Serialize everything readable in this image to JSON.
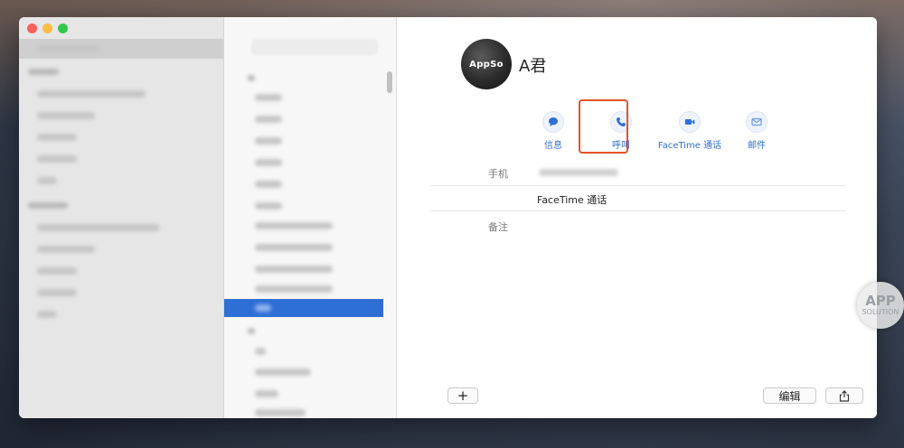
{
  "contact": {
    "name": "A君",
    "avatar_text": "AppSo"
  },
  "actions": [
    {
      "label": "信息",
      "icon": "message-icon"
    },
    {
      "label": "呼叫",
      "icon": "phone-icon"
    },
    {
      "label": "FaceTime 通话",
      "icon": "video-icon"
    },
    {
      "label": "邮件",
      "icon": "mail-icon"
    }
  ],
  "fields": {
    "mobile_label": "手机",
    "facetime_value": "FaceTime 通话",
    "notes_label": "备注"
  },
  "footer": {
    "add_label": "+",
    "edit_label": "编辑"
  },
  "watermark": {
    "line1": "APP",
    "line2": "SOLUTION"
  },
  "colors": {
    "accent": "#2f6fd6",
    "highlight": "#e6512a",
    "selection": "#2e6fd6"
  }
}
